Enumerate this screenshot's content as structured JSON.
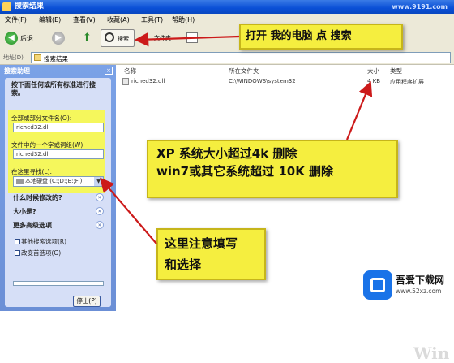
{
  "window": {
    "title": "搜索结果",
    "top_watermark": "www.9191.com"
  },
  "menu": [
    "文件(F)",
    "编辑(E)",
    "查看(V)",
    "收藏(A)",
    "工具(T)",
    "帮助(H)"
  ],
  "toolbar": {
    "back_label": "后退",
    "search_label": "搜索",
    "folders_label": "文件夹"
  },
  "address": {
    "label": "地址(D)",
    "value": "搜索结果"
  },
  "left_pane": {
    "header": "搜索助理",
    "close": "×",
    "prompt": "按下面任何或所有标准进行搜索。",
    "filename_label": "全部或部分文件名(O):",
    "filename_value": "riched32.dll",
    "phrase_label": "文件中的一个字或词组(W):",
    "phrase_value": "riched32.dll",
    "lookin_label": "在这里寻找(L):",
    "lookin_value": "本地硬盘 (C:;D:;E:;F:)",
    "sections": [
      "什么时候修改的?",
      "大小是?",
      "更多高级选项"
    ],
    "links": [
      "其他搜索选项(R)",
      "改变首选项(G)"
    ],
    "stop_button": "停止(P)"
  },
  "results": {
    "columns": [
      "名称",
      "所在文件夹",
      "大小",
      "类型"
    ],
    "rows": [
      {
        "name": "riched32.dll",
        "folder": "C:\\WINDOWS\\system32",
        "size": "4 KB",
        "type": "应用程序扩展"
      }
    ]
  },
  "annotations": {
    "callout1": "打开 我的电脑 点 搜索",
    "callout2_line1": "XP  系统大小超过4k 删除",
    "callout2_line2": "win7或其它系统超过 10K 删除",
    "callout3_line1": "这里注意填写",
    "callout3_line2": "和选择",
    "arrow_color": "#cc1a1a",
    "highlight_color": "#f5ee3f"
  },
  "watermark": {
    "brand": "吾爱下载网",
    "url": "www.52xz.com",
    "win_text": "Win"
  }
}
